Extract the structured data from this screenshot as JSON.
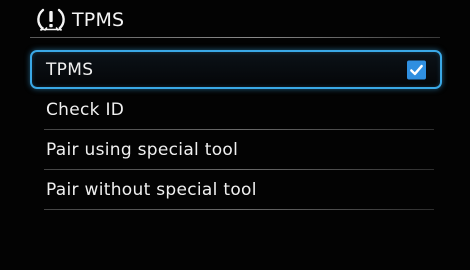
{
  "header": {
    "title": "TPMS",
    "icon": "tpms-warning-icon"
  },
  "menu": {
    "items": [
      {
        "label": "TPMS",
        "selected": true,
        "checked": true
      },
      {
        "label": "Check ID",
        "selected": false
      },
      {
        "label": "Pair using special tool",
        "selected": false
      },
      {
        "label": "Pair without special tool",
        "selected": false
      }
    ]
  },
  "colors": {
    "accent": "#3aa8e6",
    "checkbox": "#2f8fe0",
    "background": "#030303",
    "text": "#f0f0f0"
  }
}
